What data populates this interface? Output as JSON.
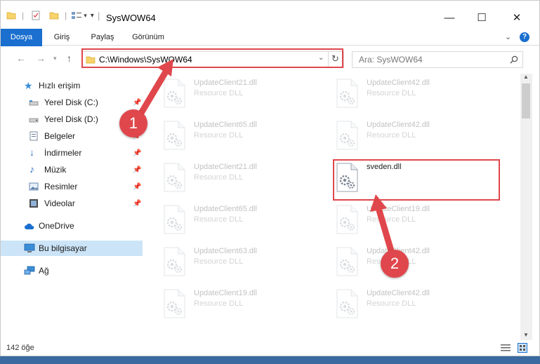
{
  "window": {
    "title": "SysWOW64",
    "controls": {
      "minimize": "—",
      "maximize": "☐",
      "close": "✕"
    }
  },
  "ribbon": {
    "tabs": [
      "Dosya",
      "Giriş",
      "Paylaş",
      "Görünüm"
    ],
    "help_label": "?"
  },
  "navbar": {
    "address": "C:\\Windows\\SysWOW64",
    "search_placeholder": "Ara: SysWOW64"
  },
  "sidebar": {
    "items": [
      {
        "label": "Hızlı erişim",
        "icon": "star-icon"
      },
      {
        "label": "Yerel Disk (C:)",
        "icon": "drive-icon",
        "pinned": true
      },
      {
        "label": "Yerel Disk (D:)",
        "icon": "drive-icon",
        "pinned": true
      },
      {
        "label": "Belgeler",
        "icon": "documents-icon",
        "pinned": true
      },
      {
        "label": "İndirmeler",
        "icon": "download-icon",
        "pinned": true
      },
      {
        "label": "Müzik",
        "icon": "music-icon",
        "pinned": true
      },
      {
        "label": "Resimler",
        "icon": "pictures-icon",
        "pinned": true
      },
      {
        "label": "Videolar",
        "icon": "videos-icon",
        "pinned": true
      },
      {
        "label": "OneDrive",
        "icon": "cloud-icon"
      },
      {
        "label": "Bu bilgisayar",
        "icon": "computer-icon",
        "selected": true
      },
      {
        "label": "Ağ",
        "icon": "network-icon"
      }
    ]
  },
  "files": [
    {
      "name": "UpdateClient21.dll",
      "type": "Resource DLL",
      "faded": true
    },
    {
      "name": "UpdateClient42.dll",
      "type": "Resource DLL",
      "faded": true
    },
    {
      "name": "UpdateClient65.dll",
      "type": "Resource DLL",
      "faded": true
    },
    {
      "name": "UpdateClient42.dll",
      "type": "Resource DLL",
      "faded": true
    },
    {
      "name": "UpdateClient21.dll",
      "type": "Resource DLL",
      "faded": true
    },
    {
      "name": "sveden.dll",
      "type": "",
      "faded": false,
      "highlighted": true
    },
    {
      "name": "UpdateClient65.dll",
      "type": "Resource DLL",
      "faded": true
    },
    {
      "name": "UpdateClient19.dll",
      "type": "Resource DLL",
      "faded": true
    },
    {
      "name": "UpdateClient63.dll",
      "type": "Resource DLL",
      "faded": true
    },
    {
      "name": "UpdateClient42.dll",
      "type": "Resource DLL",
      "faded": true
    },
    {
      "name": "UpdateClient19.dll",
      "type": "Resource DLL",
      "faded": true
    },
    {
      "name": "UpdateClient42.dll",
      "type": "Resource DLL",
      "faded": true
    }
  ],
  "status": {
    "count": "142 öğe"
  },
  "annotations": {
    "step1": "1",
    "step2": "2"
  },
  "colors": {
    "accent": "#1a6fcf",
    "annotation": "#e0474c",
    "selection": "#cce4f7"
  }
}
